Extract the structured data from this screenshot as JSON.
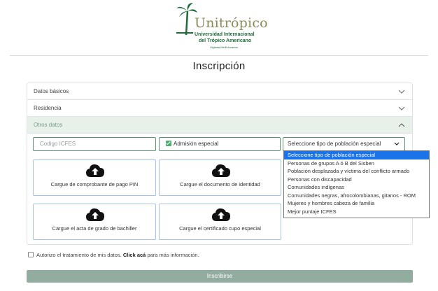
{
  "logo": {
    "brand": "Unitrópico",
    "line1": "Universidad Internacional",
    "line2": "del Trópico Americano",
    "line3": "Vigilada MinEducación"
  },
  "page": {
    "title": "Inscripción"
  },
  "accordion": {
    "sections": [
      {
        "label": "Datos básicos",
        "state": "collapsed"
      },
      {
        "label": "Residencia",
        "state": "collapsed"
      },
      {
        "label": "Otros datos",
        "state": "expanded"
      }
    ]
  },
  "form": {
    "icfes": {
      "placeholder": "Codigo ICFES",
      "value": ""
    },
    "admision": {
      "label": "Admisión especial",
      "checked": true
    },
    "poblacion": {
      "selected": "Seleccione tipo de población especial",
      "options": [
        "Seleccione tipo de población especial",
        "Personas de grupos A ó B del Sisben",
        "Población desplazada y víctima del conflicto armado",
        "Personas con discapacidad",
        "Comunidades indígenas",
        "Comunidades negras, afrocolombianas, gitanos - ROM",
        "Mujeres y hombres cabeza de familia",
        "Mejor puntaje ICFES"
      ]
    },
    "uploads": [
      {
        "label": "Cargue de comprobante de pago PIN",
        "icon": "cloud-upload-icon"
      },
      {
        "label": "Cargue el documento de identidad",
        "icon": "cloud-upload-icon"
      },
      {
        "label": "Cargue el acta de grado de bachiller",
        "icon": "cloud-upload-icon"
      },
      {
        "label": "Cargue el certificado cupo especial",
        "icon": "cloud-upload-icon"
      }
    ]
  },
  "consent": {
    "text": "Autorizo el tratamiento de mis datos.",
    "link": "Click acá",
    "suffix": "para más información.",
    "checked": false
  },
  "submit": {
    "label": "Inscribirse"
  },
  "colors": {
    "accent": "#5e9472",
    "active_header_bg": "#e7f1ea",
    "submit_bg": "#93aca0",
    "option_selected": "#1a73e8",
    "upload_border": "#a6c1e6"
  }
}
